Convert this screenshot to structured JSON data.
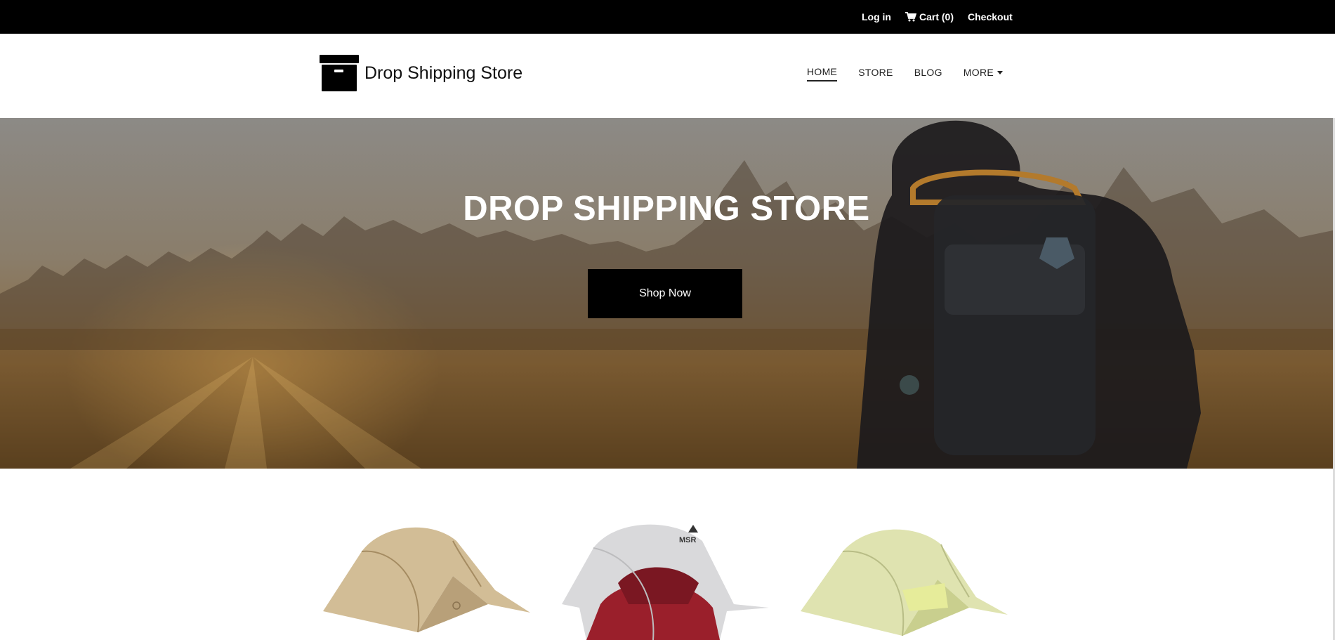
{
  "topbar": {
    "login": "Log in",
    "cart": "Cart (0)",
    "checkout": "Checkout"
  },
  "header": {
    "logo_text": "Drop Shipping Store",
    "nav": [
      {
        "label": "HOME",
        "active": true
      },
      {
        "label": "STORE"
      },
      {
        "label": "BLOG"
      },
      {
        "label": "MORE"
      }
    ]
  },
  "hero": {
    "title": "DROP SHIPPING STORE",
    "button": "Shop Now"
  },
  "products": [
    {
      "name": "tan-tent",
      "icon": "tent-image"
    },
    {
      "name": "msr-tent",
      "icon": "tent-image",
      "logo_text": "MSR"
    },
    {
      "name": "green-tent",
      "icon": "tent-image"
    }
  ],
  "colors": {
    "topbar": "#000000",
    "accent": "#000000"
  }
}
